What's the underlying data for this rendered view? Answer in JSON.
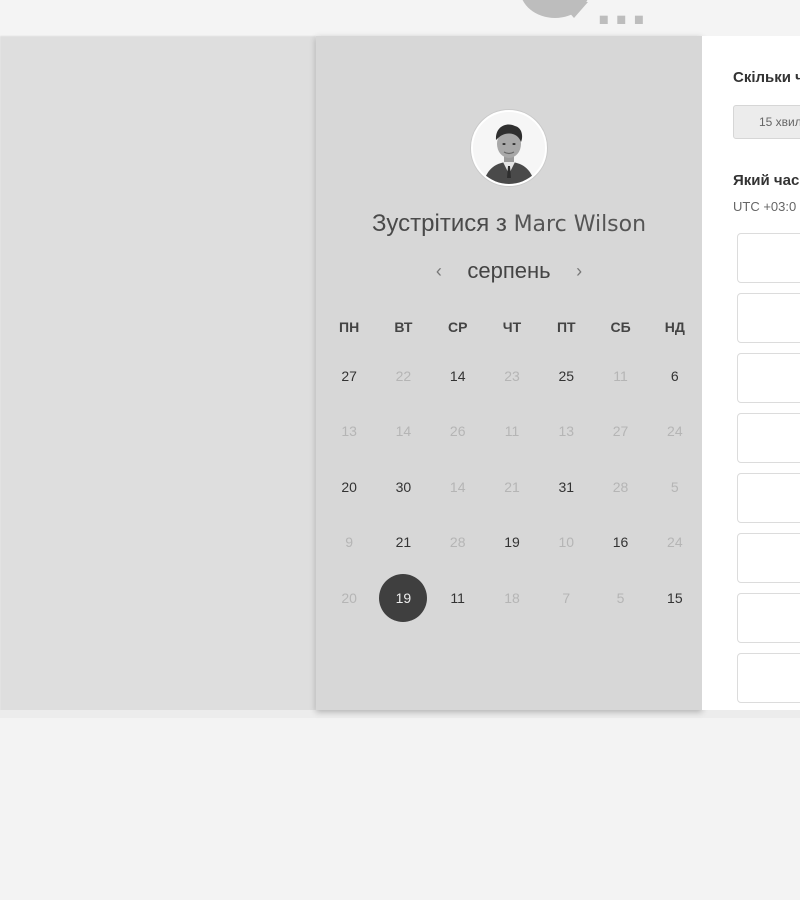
{
  "header": {
    "logo_text": "..."
  },
  "scheduler": {
    "title_prefix": "Зустрітися з",
    "host_name": "Marc Wilson",
    "month": "серпень",
    "prev_label": "‹",
    "next_label": "›",
    "weekdays": [
      "ПН",
      "ВТ",
      "СР",
      "ЧТ",
      "ПТ",
      "СБ",
      "НД"
    ],
    "weeks": [
      [
        {
          "d": "27",
          "s": "on"
        },
        {
          "d": "22",
          "s": "off"
        },
        {
          "d": "14",
          "s": "on"
        },
        {
          "d": "23",
          "s": "off"
        },
        {
          "d": "25",
          "s": "on"
        },
        {
          "d": "11",
          "s": "off"
        },
        {
          "d": "6",
          "s": "on"
        }
      ],
      [
        {
          "d": "13",
          "s": "off"
        },
        {
          "d": "14",
          "s": "off"
        },
        {
          "d": "26",
          "s": "off"
        },
        {
          "d": "11",
          "s": "off"
        },
        {
          "d": "13",
          "s": "off"
        },
        {
          "d": "27",
          "s": "off"
        },
        {
          "d": "24",
          "s": "off"
        }
      ],
      [
        {
          "d": "20",
          "s": "on"
        },
        {
          "d": "30",
          "s": "on"
        },
        {
          "d": "14",
          "s": "off"
        },
        {
          "d": "21",
          "s": "off"
        },
        {
          "d": "31",
          "s": "on"
        },
        {
          "d": "28",
          "s": "off"
        },
        {
          "d": "5",
          "s": "off"
        }
      ],
      [
        {
          "d": "9",
          "s": "off"
        },
        {
          "d": "21",
          "s": "on"
        },
        {
          "d": "28",
          "s": "off"
        },
        {
          "d": "19",
          "s": "on"
        },
        {
          "d": "10",
          "s": "off"
        },
        {
          "d": "16",
          "s": "on"
        },
        {
          "d": "24",
          "s": "off"
        }
      ],
      [
        {
          "d": "20",
          "s": "off"
        },
        {
          "d": "19",
          "s": "sel"
        },
        {
          "d": "11",
          "s": "on"
        },
        {
          "d": "18",
          "s": "off"
        },
        {
          "d": "7",
          "s": "off"
        },
        {
          "d": "5",
          "s": "off"
        },
        {
          "d": "15",
          "s": "on"
        }
      ]
    ]
  },
  "details": {
    "duration_question": "Скільки ч",
    "duration_option": "15 хвил",
    "time_question": "Який час",
    "timezone": "UTC +03:0"
  },
  "colors": {
    "selected_day": "#3f3f3f",
    "panel": "#d7d7d7"
  }
}
